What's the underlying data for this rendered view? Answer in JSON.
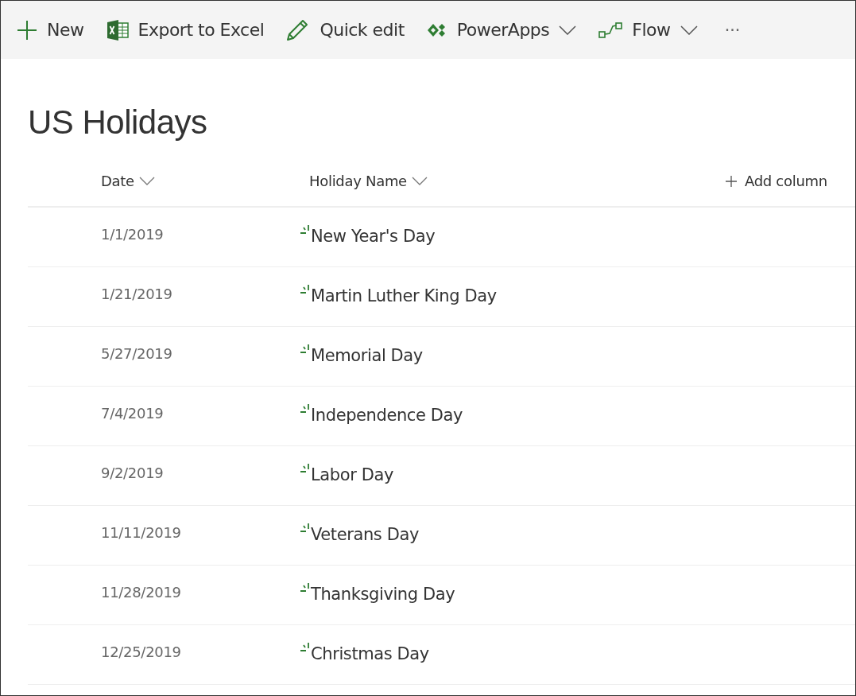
{
  "toolbar": [
    {
      "kind": "plus",
      "label": "New",
      "has_menu": false
    },
    {
      "kind": "excel",
      "label": "Export to Excel",
      "has_menu": false
    },
    {
      "kind": "pencil",
      "label": "Quick edit",
      "has_menu": false
    },
    {
      "kind": "powerapps",
      "label": "PowerApps",
      "has_menu": true
    },
    {
      "kind": "flow",
      "label": "Flow",
      "has_menu": true
    },
    {
      "kind": "more",
      "label": "···",
      "has_menu": false
    }
  ],
  "title": "US Holidays",
  "columns": [
    {
      "label": "Date",
      "sortable": true
    },
    {
      "label": "Holiday Name",
      "sortable": true
    }
  ],
  "add_column": "Add column",
  "rows": [
    {
      "date": "1/1/2019",
      "name": "New Year's Day",
      "new": true
    },
    {
      "date": "1/21/2019",
      "name": "Martin Luther King Day",
      "new": true
    },
    {
      "date": "5/27/2019",
      "name": "Memorial Day",
      "new": true
    },
    {
      "date": "7/4/2019",
      "name": "Independence Day",
      "new": true
    },
    {
      "date": "9/2/2019",
      "name": "Labor Day",
      "new": true
    },
    {
      "date": "11/11/2019",
      "name": "Veterans Day",
      "new": true
    },
    {
      "date": "11/28/2019",
      "name": "Thanksgiving Day",
      "new": true
    },
    {
      "date": "12/25/2019",
      "name": "Christmas Day",
      "new": true
    }
  ]
}
